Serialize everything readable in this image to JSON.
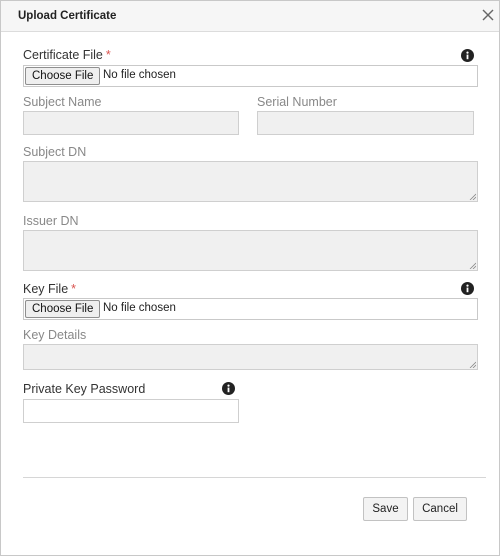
{
  "dialog": {
    "title": "Upload Certificate"
  },
  "certificate_file": {
    "label": "Certificate File",
    "required_mark": "*",
    "choose_label": "Choose File",
    "status": "No file chosen"
  },
  "subject_name": {
    "label": "Subject Name",
    "value": ""
  },
  "serial_number": {
    "label": "Serial Number",
    "value": ""
  },
  "subject_dn": {
    "label": "Subject DN",
    "value": ""
  },
  "issuer_dn": {
    "label": "Issuer DN",
    "value": ""
  },
  "key_file": {
    "label": "Key File",
    "required_mark": "*",
    "choose_label": "Choose File",
    "status": "No file chosen"
  },
  "key_details": {
    "label": "Key Details",
    "value": ""
  },
  "private_key_password": {
    "label": "Private Key Password",
    "value": ""
  },
  "footer": {
    "save_label": "Save",
    "cancel_label": "Cancel"
  },
  "icons": {
    "close": "close-icon",
    "info": "info-icon"
  },
  "colors": {
    "required": "#d9534f",
    "header_bg": "#f6f6f6",
    "readonly_bg": "#f0f0f0"
  }
}
